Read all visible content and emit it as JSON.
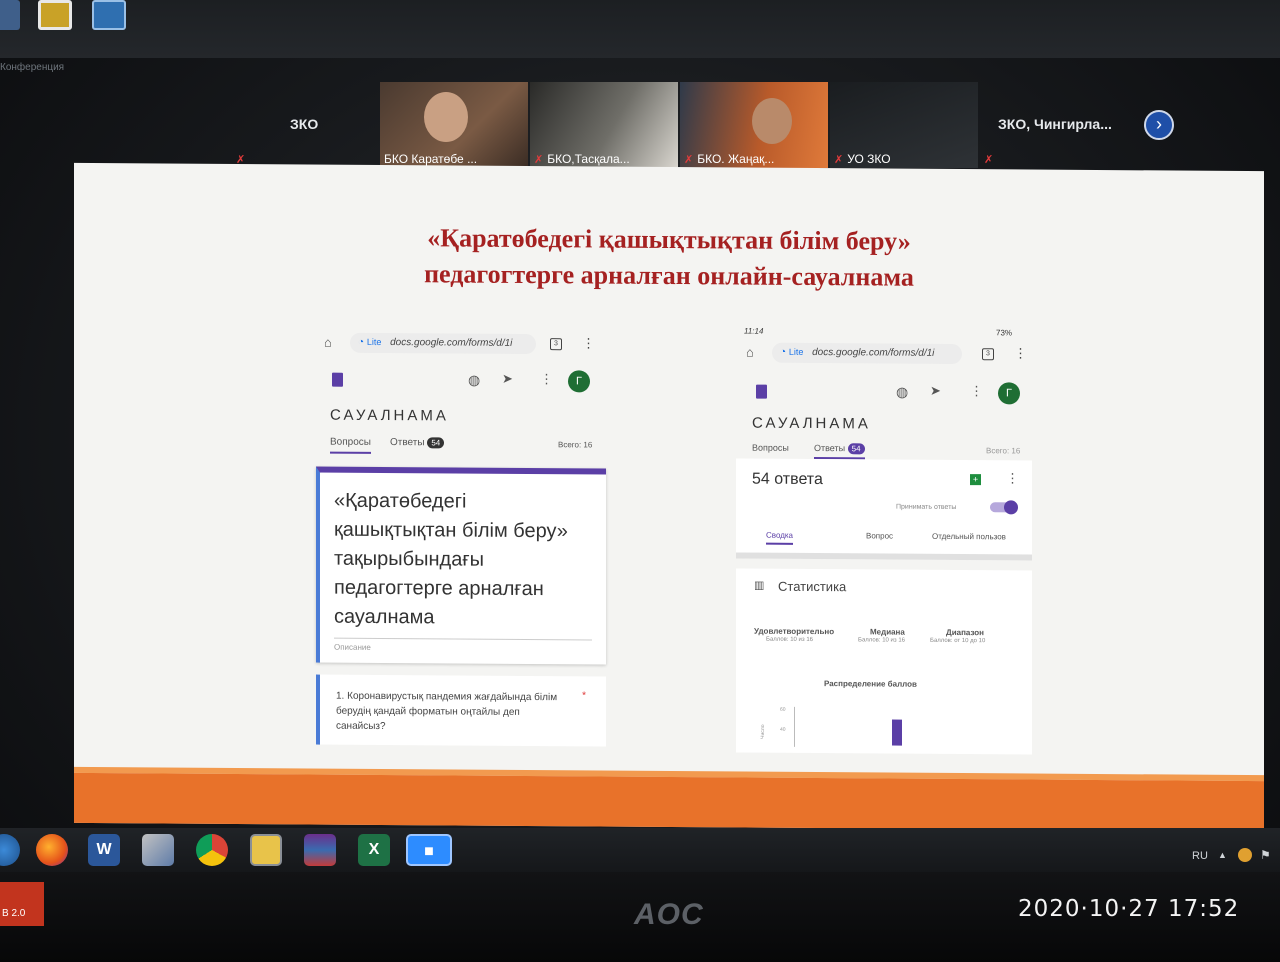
{
  "desktop": {
    "conference_label": "Конференция"
  },
  "participants": [
    {
      "name": "ЗКО",
      "type": "name-only"
    },
    {
      "name": "БКО Каратөбе ...",
      "type": "video"
    },
    {
      "name": "БКО,Тасқала...",
      "type": "video"
    },
    {
      "name": "БКО. Жаңақ...",
      "type": "video"
    },
    {
      "name": "УО ЗКО",
      "type": "video"
    },
    {
      "name": "ЗКО, Чингирла...",
      "type": "name-only"
    }
  ],
  "slide": {
    "title_line1": "«Қаратөбедегі қашықтықтан білім беру»",
    "title_line2": "педагогтерге арналған онлайн-сауалнама",
    "left_phone": {
      "url_lite": "Lite",
      "url": "docs.google.com/forms/d/1i",
      "tab_count": "3",
      "avatar_letter": "Г",
      "form_title": "САУАЛНАМА",
      "tab_questions": "Вопросы",
      "tab_answers": "Ответы",
      "answers_badge": "54",
      "total": "Всего: 16",
      "heading": "«Қаратөбедегі қашықтықтан білім беру» тақырыбындағы педагогтерге арналған сауалнама",
      "description_placeholder": "Описание",
      "question": "1.   Коронавирустық пандемия жағдайында білім берудің қандай форматын оңтайлы деп санайсыз?",
      "required_mark": "*"
    },
    "right_phone": {
      "status_time": "11:14",
      "status_right": "73%",
      "url_lite": "Lite",
      "url": "docs.google.com/forms/d/1i",
      "tab_count": "3",
      "avatar_letter": "Г",
      "form_title": "САУАЛНАМА",
      "tab_questions": "Вопросы",
      "tab_answers": "Ответы",
      "answers_badge": "54",
      "total": "Всего: 16",
      "responses_count": "54 ответа",
      "accept_responses": "Принимать ответы",
      "subtab_summary": "Сводка",
      "subtab_question": "Вопрос",
      "subtab_individual": "Отдельный пользов",
      "statistics": "Статистика",
      "stat1_label": "Удовлетворительно",
      "stat1_value": "Баллов: 10 из 16",
      "stat2_label": "Медиана",
      "stat2_value": "Баллов: 10 из 16",
      "stat3_label": "Диапазон",
      "stat3_value": "Баллов: от 10 до 10",
      "distribution_title": "Распределение баллов",
      "axis_tick_top": "60",
      "axis_tick_mid": "40",
      "axis_label": "Число"
    }
  },
  "taskbar": {
    "language": "RU",
    "apps": [
      "windows-start",
      "firefox",
      "word",
      "paint",
      "chrome",
      "explorer",
      "winrar",
      "excel",
      "zoom"
    ]
  },
  "monitor": {
    "brand": "AOC",
    "usb_label": "B 2.0"
  },
  "camera_timestamp": "2020·10·27  17:52",
  "colors": {
    "slide_title": "#a52121",
    "slide_bottom": "#e8722a",
    "accent_purple": "#5b3fa6",
    "zoom_blue": "#2d8cff"
  }
}
